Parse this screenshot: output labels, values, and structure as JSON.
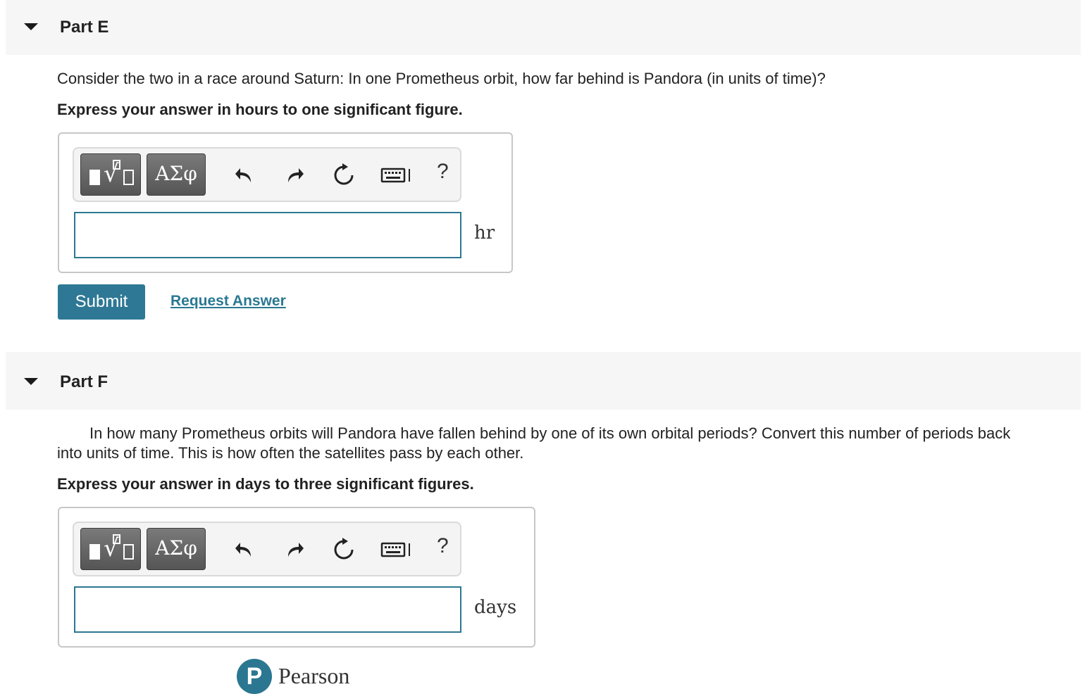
{
  "part_e": {
    "title": "Part E",
    "question": "Consider the two in a race around Saturn: In one Prometheus orbit, how far behind is Pandora (in units of time)?",
    "instruction": "Express your answer in hours to one significant figure.",
    "answer_value": "",
    "unit": "hr"
  },
  "part_f": {
    "title": "Part F",
    "question_line1": "In how many Prometheus orbits will Pandora have fallen behind by one of its own orbital periods? Convert this number of periods back",
    "question_line2": "into units of time. This is how often the satellites pass by each other.",
    "instruction": "Express your answer in days to three significant figures.",
    "answer_value": "",
    "unit": "days"
  },
  "toolbar": {
    "greek_label": "ΑΣφ",
    "help_label": "?",
    "icons": [
      "templates-icon",
      "greek-symbols-icon",
      "undo-icon",
      "redo-icon",
      "reset-icon",
      "keyboard-icon",
      "help-icon"
    ]
  },
  "actions": {
    "submit_label": "Submit",
    "request_answer_label": "Request Answer"
  },
  "footer": {
    "logo_letter": "P",
    "brand": "Pearson"
  },
  "colors": {
    "accent": "#2e7895",
    "header_bg": "#f6f6f6",
    "toolbar_button": "#666666"
  }
}
